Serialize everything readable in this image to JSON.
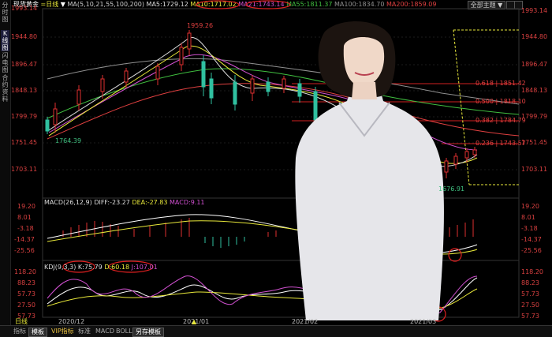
{
  "left_tabs": [
    "分时图",
    "K线图",
    "闪电图",
    "合约资料"
  ],
  "header": {
    "title": "现货黄金",
    "period": "日线",
    "ma_params": "MA(5,10,21,55,100,200)",
    "ma5": "MA5:1729.12",
    "ma10": "MA10:1717.02",
    "ma21": "MA21:1743.14",
    "ma55": "MA55:1811.37",
    "ma100": "MA100:1834.70",
    "ma200": "MA200:1859.09",
    "theme_button": "全部主题 ▼",
    "colors": {
      "ma5": "#dddddd",
      "ma10": "#e8e83a",
      "ma21": "#d050d0",
      "ma55": "#40c040",
      "ma100": "#909090",
      "ma200": "#e04040",
      "bull": "#e03030",
      "bear": "#30c0a0"
    }
  },
  "main_chart": {
    "y_labels": [
      "1993.14",
      "1944.80",
      "1896.47",
      "1848.13",
      "1799.79",
      "1751.45",
      "1703.11"
    ],
    "high_label": "1959.26",
    "low_left_label": "1764.39",
    "low_right_label": "1676.91",
    "fib_levels": [
      {
        "label": "0.618 | 1851.42",
        "value": 1851.42
      },
      {
        "label": "0.500 | 1818.10",
        "value": 1818.1
      },
      {
        "label": "0.382 | 1784.79",
        "value": 1784.79
      },
      {
        "label": "0.236 | 1743.57",
        "value": 1743.57
      }
    ]
  },
  "macd": {
    "title": "MACD(26,12,9)",
    "diff": "DIFF:-23.27",
    "dea": "DEA:-27.83",
    "macd": "MACD:9.11",
    "y_labels": [
      "19.20",
      "8.01",
      "-3.18",
      "-14.37",
      "-25.56"
    ]
  },
  "kdj": {
    "title": "KDJ(9,3,3)",
    "k": "K:75.79",
    "d": "D:60.18",
    "j": "J:107.01",
    "y_labels": [
      "118.20",
      "88.23",
      "57.73",
      "27.50",
      "57.73"
    ]
  },
  "x_labels": [
    "2020/12",
    "2021/01",
    "2021/02",
    "2021/03"
  ],
  "bottom_tabs": [
    "日线",
    "指标",
    "模板",
    "VIP指标",
    "标准",
    "MACD",
    "BOLL",
    "另存模板"
  ],
  "bottom_scroll": "▲"
}
